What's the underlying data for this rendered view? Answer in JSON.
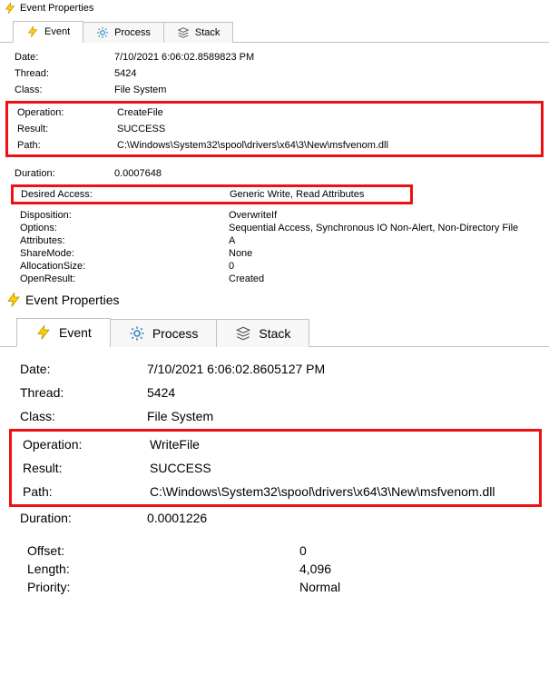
{
  "window_title": "Event Properties",
  "tabs": {
    "event": "Event",
    "process": "Process",
    "stack": "Stack"
  },
  "panel1": {
    "date_label": "Date:",
    "date": "7/10/2021 6:06:02.8589823 PM",
    "thread_label": "Thread:",
    "thread": "5424",
    "class_label": "Class:",
    "class": "File System",
    "operation_label": "Operation:",
    "operation": "CreateFile",
    "result_label": "Result:",
    "result": "SUCCESS",
    "path_label": "Path:",
    "path": "C:\\Windows\\System32\\spool\\drivers\\x64\\3\\New\\msfvenom.dll",
    "duration_label": "Duration:",
    "duration": "0.0007648",
    "desired_access_label": "Desired Access:",
    "desired_access": "Generic Write, Read Attributes",
    "disposition_label": "Disposition:",
    "disposition": "OverwriteIf",
    "options_label": "Options:",
    "options": "Sequential Access, Synchronous IO Non-Alert, Non-Directory File",
    "attributes_label": "Attributes:",
    "attributes": "A",
    "sharemode_label": "ShareMode:",
    "sharemode": "None",
    "allocationsize_label": "AllocationSize:",
    "allocationsize": "0",
    "openresult_label": "OpenResult:",
    "openresult": "Created"
  },
  "panel2": {
    "date_label": "Date:",
    "date": "7/10/2021 6:06:02.8605127 PM",
    "thread_label": "Thread:",
    "thread": "5424",
    "class_label": "Class:",
    "class": "File System",
    "operation_label": "Operation:",
    "operation": "WriteFile",
    "result_label": "Result:",
    "result": "SUCCESS",
    "path_label": "Path:",
    "path": "C:\\Windows\\System32\\spool\\drivers\\x64\\3\\New\\msfvenom.dll",
    "duration_label": "Duration:",
    "duration": "0.0001226",
    "offset_label": "Offset:",
    "offset": "0",
    "length_label": "Length:",
    "length": "4,096",
    "priority_label": "Priority:",
    "priority": "Normal"
  }
}
